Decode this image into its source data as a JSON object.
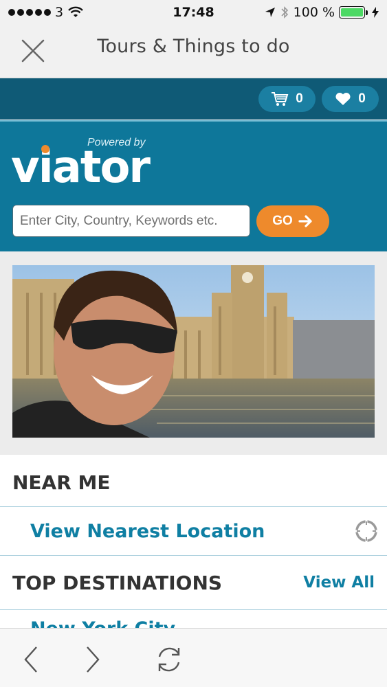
{
  "status_bar": {
    "carrier": "3",
    "time": "17:48",
    "battery_percent": "100 %",
    "battery_level": 1.0,
    "icons": [
      "signal-dots-icon",
      "wifi-icon",
      "location-arrow-icon",
      "bluetooth-icon",
      "battery-icon",
      "charging-bolt-icon"
    ]
  },
  "nav": {
    "title": "Tours & Things to do",
    "close_icon": "close-icon"
  },
  "cart_bar": {
    "cart_count": "0",
    "wishlist_count": "0"
  },
  "brand": {
    "powered_by": "Powered by",
    "logo": "viator"
  },
  "search": {
    "placeholder": "Enter City, Country, Keywords etc.",
    "value": "",
    "go_label": "GO"
  },
  "near_me": {
    "heading": "NEAR ME",
    "nearest_label": "View Nearest Location"
  },
  "top_destinations": {
    "heading": "TOP DESTINATIONS",
    "view_all": "View All",
    "first_item": "New York City"
  },
  "colors": {
    "teal": "#0e779a",
    "dark_teal": "#0f5a76",
    "orange": "#ee8a2c",
    "link": "#0f7fa3"
  }
}
